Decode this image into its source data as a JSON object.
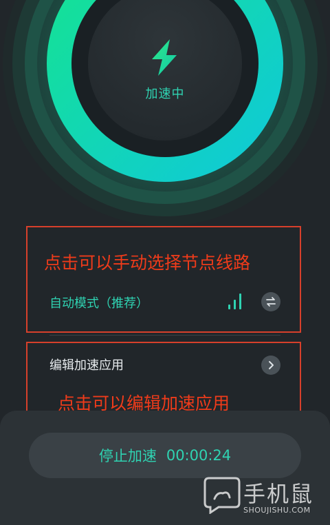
{
  "boost": {
    "status": "加速中",
    "icon": "lightning-bolt-icon",
    "accent_color": "#2fd3b2",
    "ring_gradient": [
      "#15e48e",
      "#0fd0d8"
    ]
  },
  "annotations": {
    "select_node_hint": "点击可以手动选择节点线路",
    "edit_apps_hint": "点击可以编辑加速应用",
    "color": "#ef3b1a"
  },
  "node_selection": {
    "mode_label": "自动模式（推荐）",
    "signal_icon": "signal-strength-icon",
    "switch_icon": "swap-arrows-icon"
  },
  "apps": {
    "edit_label": "编辑加速应用",
    "chevron_icon": "chevron-right-icon"
  },
  "stop_control": {
    "label": "停止加速",
    "elapsed": "00:00:24"
  },
  "watermark": {
    "brand": "手机鼠",
    "site": "SHOUJISHU.COM",
    "logo_icon": "chat-bubble-logo-icon"
  }
}
